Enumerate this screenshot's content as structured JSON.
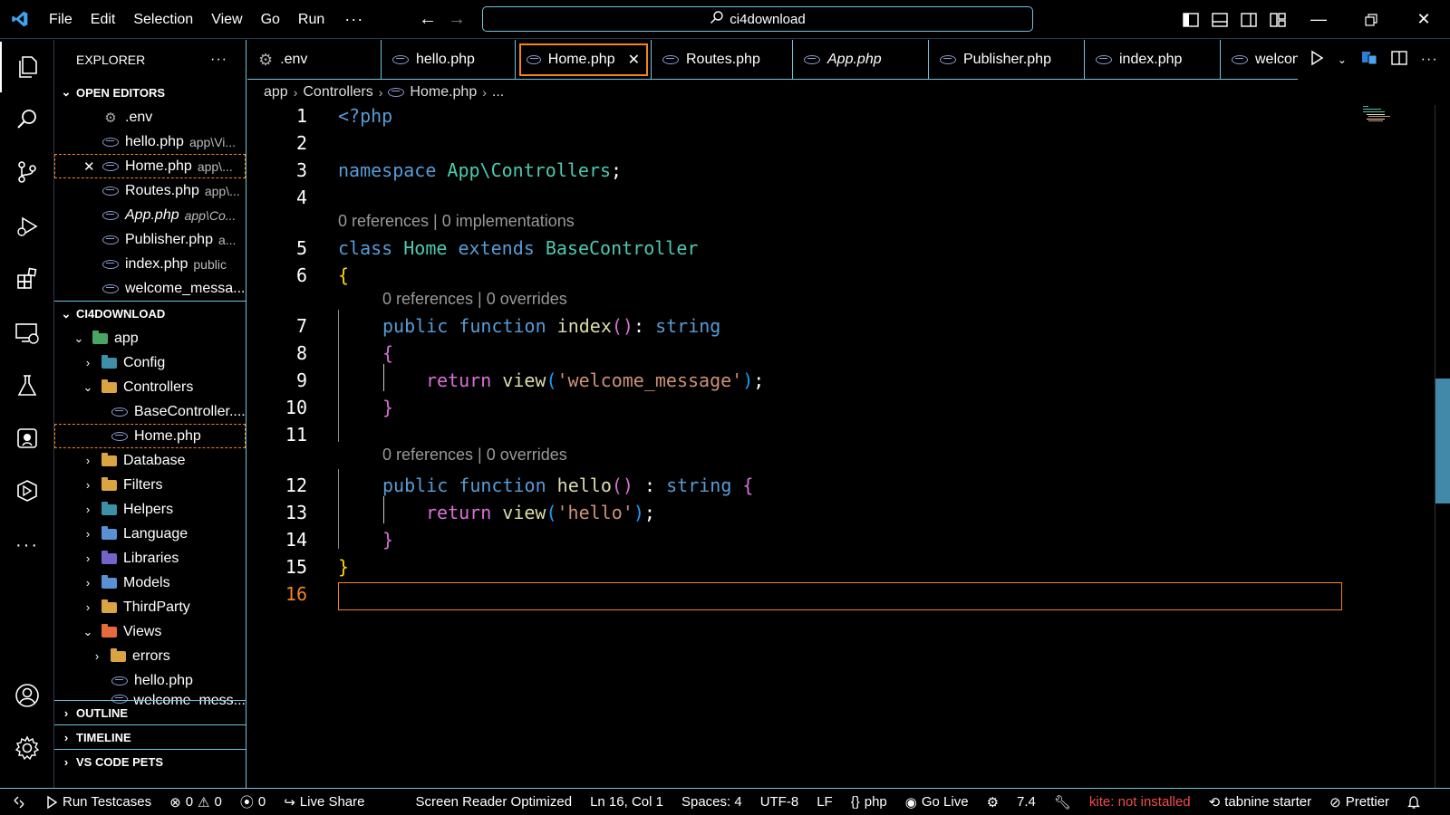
{
  "titlebar": {
    "menu": [
      "File",
      "Edit",
      "Selection",
      "View",
      "Go",
      "Run"
    ],
    "more": "···",
    "search_text": "ci4download"
  },
  "sidebar": {
    "title": "EXPLORER",
    "more": "···",
    "open_editors_title": "OPEN EDITORS",
    "open_editors": [
      {
        "name": ".env",
        "desc": ""
      },
      {
        "name": "hello.php",
        "desc": "app\\Vi..."
      },
      {
        "name": "Home.php",
        "desc": "app\\..."
      },
      {
        "name": "Routes.php",
        "desc": "app\\..."
      },
      {
        "name": "App.php",
        "desc": "app\\Co..."
      },
      {
        "name": "Publisher.php",
        "desc": "a..."
      },
      {
        "name": "index.php",
        "desc": "public"
      },
      {
        "name": "welcome_messa...",
        "desc": ""
      }
    ],
    "project_title": "CI4DOWNLOAD",
    "tree": {
      "app": "app",
      "config": "Config",
      "controllers": "Controllers",
      "basecontroller": "BaseController....",
      "home": "Home.php",
      "database": "Database",
      "filters": "Filters",
      "helpers": "Helpers",
      "language": "Language",
      "libraries": "Libraries",
      "models": "Models",
      "thirdparty": "ThirdParty",
      "views": "Views",
      "errors": "errors",
      "hello": "hello.php",
      "welcome": "welcome_mess..."
    },
    "outline": "OUTLINE",
    "timeline": "TIMELINE",
    "pets": "VS CODE PETS"
  },
  "tabs": [
    ".env",
    "hello.php",
    "Home.php",
    "Routes.php",
    "App.php",
    "Publisher.php",
    "index.php",
    "welcon"
  ],
  "breadcrumb": [
    "app",
    "Controllers",
    "Home.php",
    "..."
  ],
  "editor": {
    "line_numbers": [
      "1",
      "2",
      "3",
      "4",
      "5",
      "6",
      "7",
      "8",
      "9",
      "10",
      "11",
      "12",
      "13",
      "14",
      "15",
      "16"
    ],
    "l1": "<?php",
    "l3_kw": "namespace",
    "l3_ns": "App\\Controllers",
    "l3_end": ";",
    "lens_class": "0 references | 0 implementations",
    "l5_class": "class",
    "l5_name": "Home",
    "l5_extends": "extends",
    "l5_base": "BaseController",
    "l6": "{",
    "lens_index": "0 references | 0 overrides",
    "l7_public": "public",
    "l7_function": "function",
    "l7_name": "index",
    "l7_parens": "()",
    "l7_colon": ":",
    "l7_type": "string",
    "l8": "{",
    "l9_return": "return",
    "l9_view": "view",
    "l9_open": "(",
    "l9_str": "'welcome_message'",
    "l9_close": ")",
    "l9_semi": ";",
    "l10": "}",
    "lens_hello": "0 references | 0 overrides",
    "l12_public": "public",
    "l12_function": "function",
    "l12_name": "hello",
    "l12_parens": "()",
    "l12_colon": ":",
    "l12_type": "string",
    "l12_brace": "{",
    "l13_return": "return",
    "l13_view": "view",
    "l13_open": "(",
    "l13_str": "'hello'",
    "l13_close": ")",
    "l13_semi": ";",
    "l14": "}",
    "l15": "}"
  },
  "statusbar": {
    "run": "Run Testcases",
    "errors": "0",
    "warnings": "0",
    "ports": "0",
    "liveshare": "Live Share",
    "screenreader": "Screen Reader Optimized",
    "position": "Ln 16, Col 1",
    "spaces": "Spaces: 4",
    "encoding": "UTF-8",
    "eol": "LF",
    "language": "php",
    "golive": "Go Live",
    "version": "7.4",
    "kite": "kite: not installed",
    "tabnine": "tabnine starter",
    "prettier": "Prettier"
  },
  "colors": {
    "accent_border": "#6fc3df",
    "active_outline": "#f38518",
    "keyword": "#569cd6",
    "class": "#4ec9b0",
    "function": "#dcdcaa",
    "string": "#ce9178"
  }
}
